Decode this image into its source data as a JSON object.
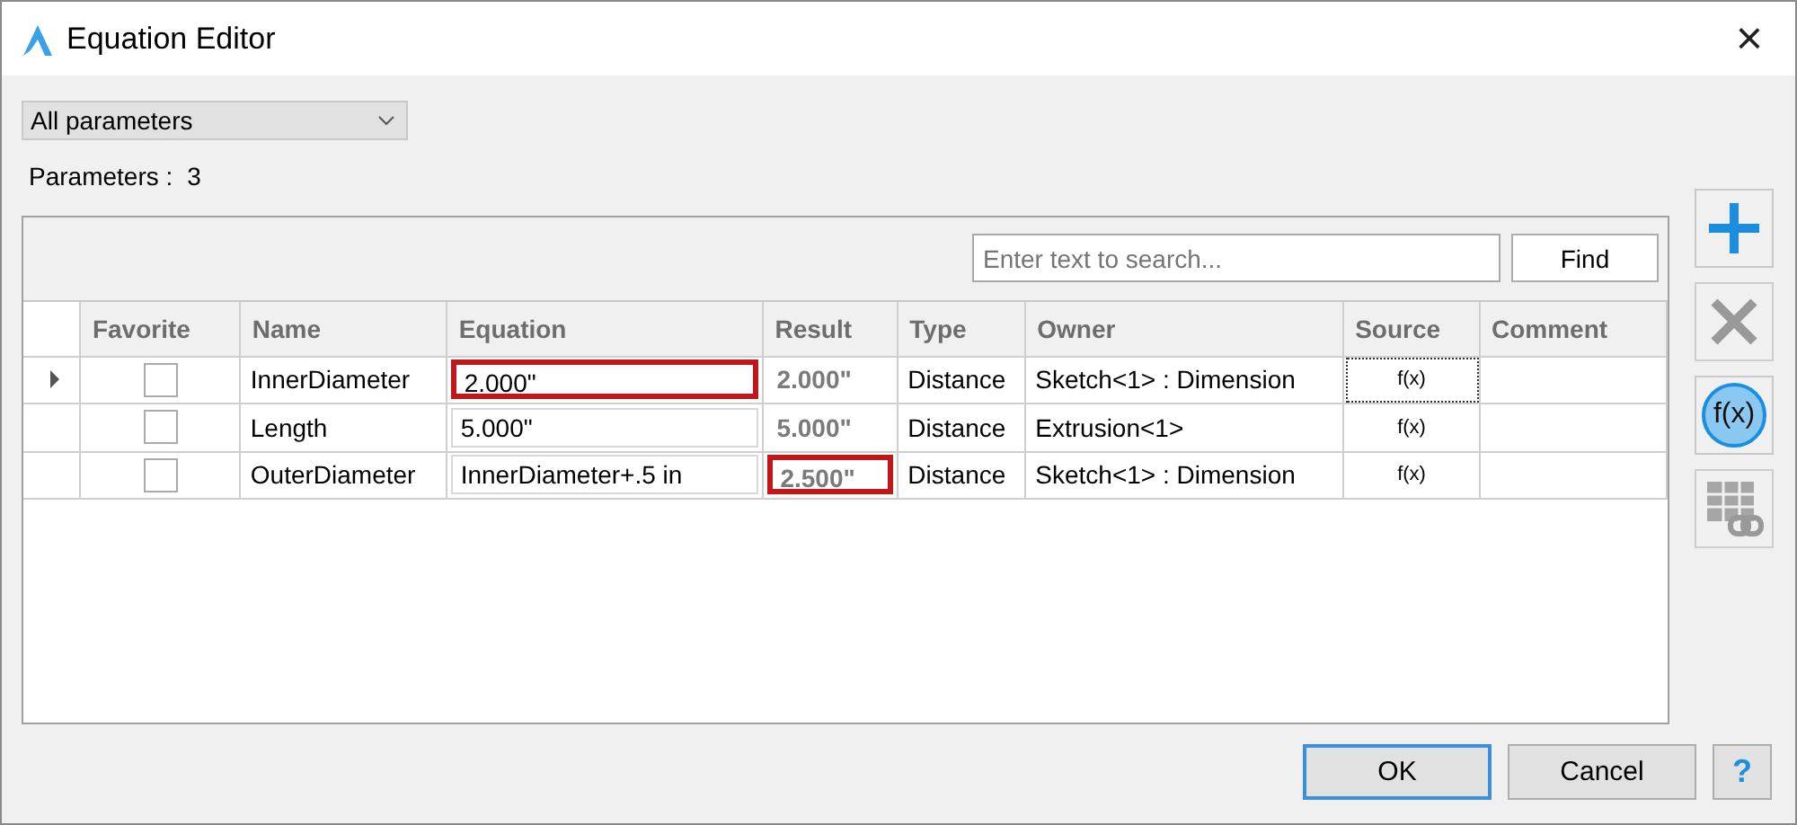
{
  "window": {
    "title": "Equation Editor",
    "close": "×"
  },
  "filter": {
    "value": "All parameters"
  },
  "count": {
    "label": "Parameters :",
    "value": "3"
  },
  "search": {
    "placeholder": "Enter text to search...",
    "button": "Find"
  },
  "table": {
    "columns": [
      "Favorite",
      "Name",
      "Equation",
      "Result",
      "Type",
      "Owner",
      "Source",
      "Comment"
    ],
    "rows": [
      {
        "current": true,
        "favorite": false,
        "name": "InnerDiameter",
        "equation": "2.000\"",
        "equation_highlighted": true,
        "result": "2.000\"",
        "result_highlighted": false,
        "type": "Distance",
        "owner": "Sketch<1> : Dimension",
        "source": "f(x)",
        "source_focused": true
      },
      {
        "current": false,
        "favorite": false,
        "name": "Length",
        "equation": "5.000\"",
        "equation_highlighted": false,
        "result": "5.000\"",
        "result_highlighted": false,
        "type": "Distance",
        "owner": "Extrusion<1>",
        "source": "f(x)",
        "source_focused": false
      },
      {
        "current": false,
        "favorite": false,
        "name": "OuterDiameter",
        "equation": "InnerDiameter+.5 in",
        "equation_highlighted": false,
        "result": "2.500\"",
        "result_highlighted": true,
        "type": "Distance",
        "owner": "Sketch<1> : Dimension",
        "source": "f(x)",
        "source_focused": false
      }
    ]
  },
  "side_buttons": [
    {
      "kind": "add",
      "disabled": false
    },
    {
      "kind": "delete",
      "disabled": true
    },
    {
      "kind": "function",
      "label": "f(x)",
      "disabled": false
    },
    {
      "kind": "link-table",
      "disabled": true
    }
  ],
  "buttons": [
    {
      "kind": "ok",
      "label": "OK"
    },
    {
      "kind": "cancel",
      "label": "Cancel"
    },
    {
      "kind": "help",
      "label": "?"
    }
  ]
}
